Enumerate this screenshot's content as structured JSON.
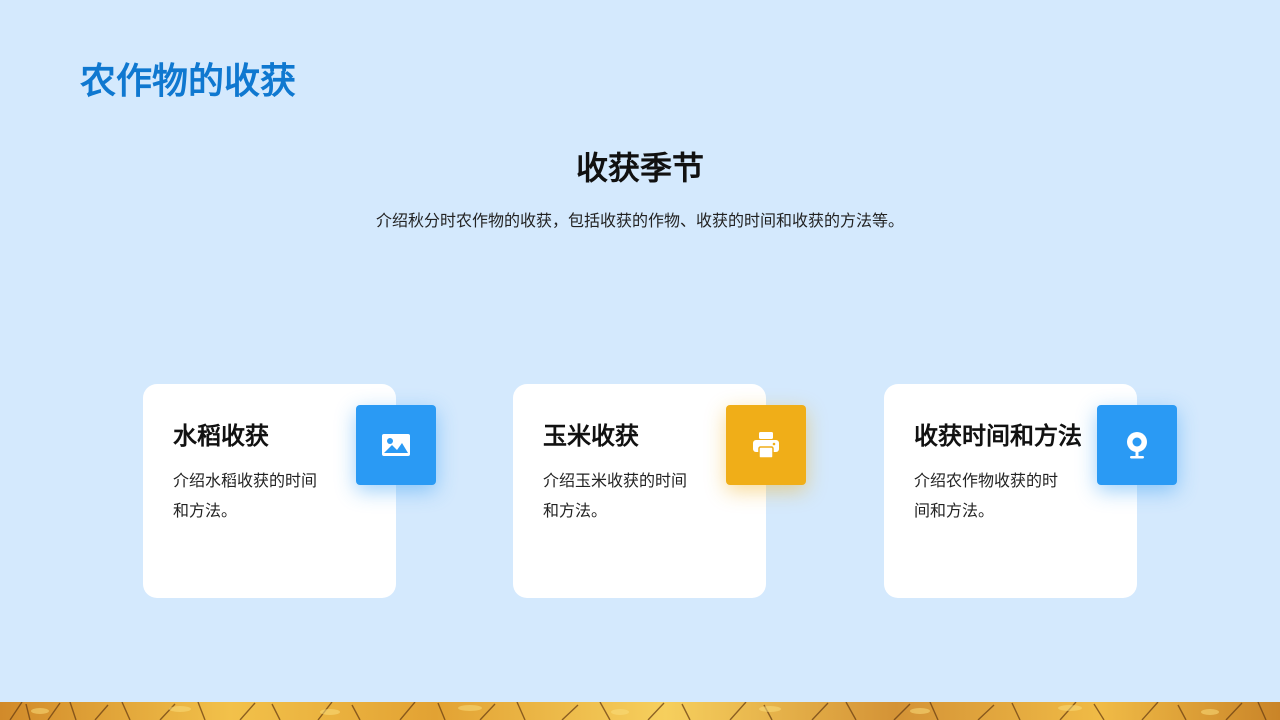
{
  "header": {
    "title": "农作物的收获"
  },
  "section": {
    "title": "收获季节",
    "description": "介绍秋分时农作物的收获，包括收获的作物、收获的时间和收获的方法等。"
  },
  "cards": [
    {
      "title": "水稻收获",
      "description": "介绍水稻收获的时间和方法。",
      "icon": "image-icon",
      "accent": "#2a9af4"
    },
    {
      "title": "玉米收获",
      "description": "介绍玉米收获的时间和方法。",
      "icon": "printer-icon",
      "accent": "#f0ae18"
    },
    {
      "title": "收获时间和方法",
      "description": "介绍农作物收获的时间和方法。",
      "icon": "webcam-icon",
      "accent": "#2a9af4"
    }
  ],
  "colors": {
    "background": "#d4e9fd",
    "title": "#0f78d0",
    "card": "#ffffff"
  }
}
